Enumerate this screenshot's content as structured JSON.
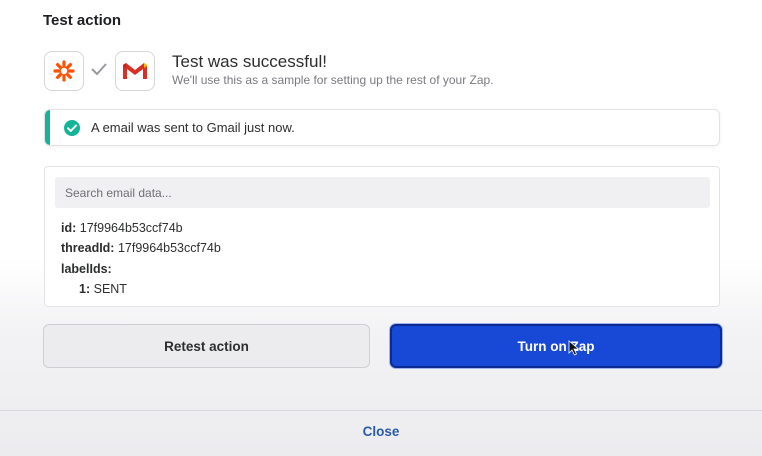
{
  "heading": "Test action",
  "apps": {
    "trigger_icon": "zapier-icon",
    "action_icon": "gmail-icon",
    "connector_icon": "check-icon"
  },
  "success": {
    "title": "Test was successful!",
    "subtitle": "We'll use this as a sample for setting up the rest of your Zap."
  },
  "alert": {
    "text": "A email was sent to Gmail just now.",
    "color": "#13b497"
  },
  "data_panel": {
    "search_placeholder": "Search email data...",
    "fields": [
      {
        "key": "id:",
        "value": "17f9964b53ccf74b"
      },
      {
        "key": "threadId:",
        "value": "17f9964b53ccf74b"
      },
      {
        "key": "labelIds:",
        "value": ""
      },
      {
        "key": "1:",
        "value": "SENT"
      }
    ]
  },
  "buttons": {
    "retest": "Retest action",
    "turn_on": "Turn on Zap"
  },
  "footer": {
    "close": "Close"
  },
  "colors": {
    "primary": "#1848d6",
    "link": "#2a5aa8",
    "zapier_orange": "#ff4f00"
  }
}
